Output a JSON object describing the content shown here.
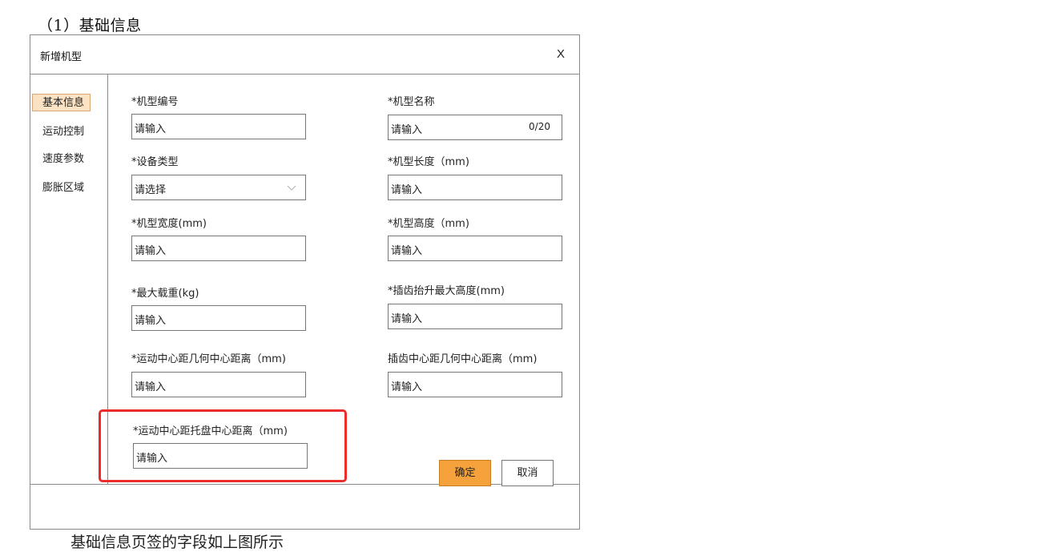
{
  "section_heading": "（1）基础信息",
  "dialog": {
    "title": "新增机型",
    "close_label": "X"
  },
  "nav": {
    "items": [
      {
        "label": "基本信息",
        "active": true
      },
      {
        "label": "运动控制",
        "active": false
      },
      {
        "label": "速度参数",
        "active": false
      },
      {
        "label": "膨胀区域",
        "active": false
      }
    ]
  },
  "form": {
    "model_code": {
      "label": "*机型编号",
      "placeholder": "请输入"
    },
    "model_name": {
      "label": "*机型名称",
      "placeholder": "请输入",
      "counter": "0/20"
    },
    "device_type": {
      "label": "*设备类型",
      "placeholder": "请选择"
    },
    "model_length": {
      "label": "*机型长度（mm)",
      "placeholder": "请输入"
    },
    "model_width": {
      "label": "*机型宽度(mm)",
      "placeholder": "请输入"
    },
    "model_height": {
      "label": "*机型高度（mm)",
      "placeholder": "请输入"
    },
    "max_load": {
      "label": "*最大载重(kg)",
      "placeholder": "请输入"
    },
    "fork_max_lift": {
      "label": "*插齿抬升最大高度(mm)",
      "placeholder": "请输入"
    },
    "motion_to_geo": {
      "label": "*运动中心距几何中心距离（mm)",
      "placeholder": "请输入"
    },
    "fork_to_geo": {
      "label": "插齿中心距几何中心距离（mm)",
      "placeholder": "请输入"
    },
    "motion_to_tray": {
      "label": "*运动中心距托盘中心距离（mm)",
      "placeholder": "请输入"
    }
  },
  "footer": {
    "ok_label": "确定",
    "cancel_label": "取消"
  },
  "bottom_text": "基础信息页签的字段如上图所示",
  "colors": {
    "accent": "#f5a23c",
    "active_nav_bg": "#fbe2c3",
    "highlight_border": "#ec2b2b"
  }
}
